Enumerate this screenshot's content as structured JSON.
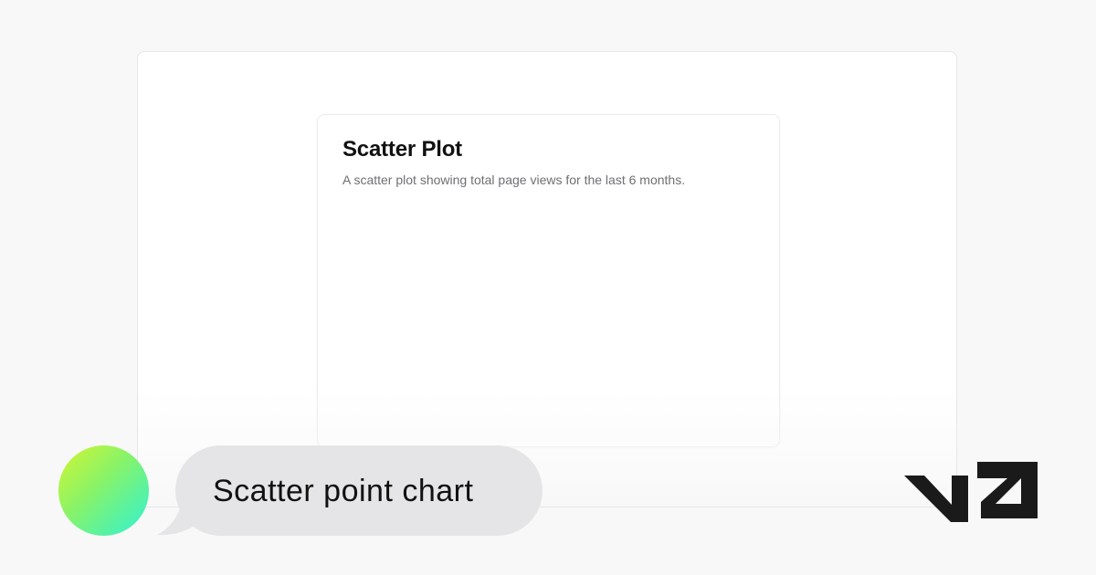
{
  "card": {
    "title": "Scatter Plot",
    "description": "A scatter plot showing total page views for the last 6 months."
  },
  "chat": {
    "message": "Scatter point chart"
  },
  "brand": {
    "logo_icon": "v0-logo-icon"
  },
  "colors": {
    "page_background": "#f8f8f8",
    "card_background": "#ffffff",
    "bubble_background": "#e5e5e7",
    "logo": "#1a1a1a",
    "avatar_gradient_start": "#d4f531",
    "avatar_gradient_end": "#2ef2d6"
  }
}
